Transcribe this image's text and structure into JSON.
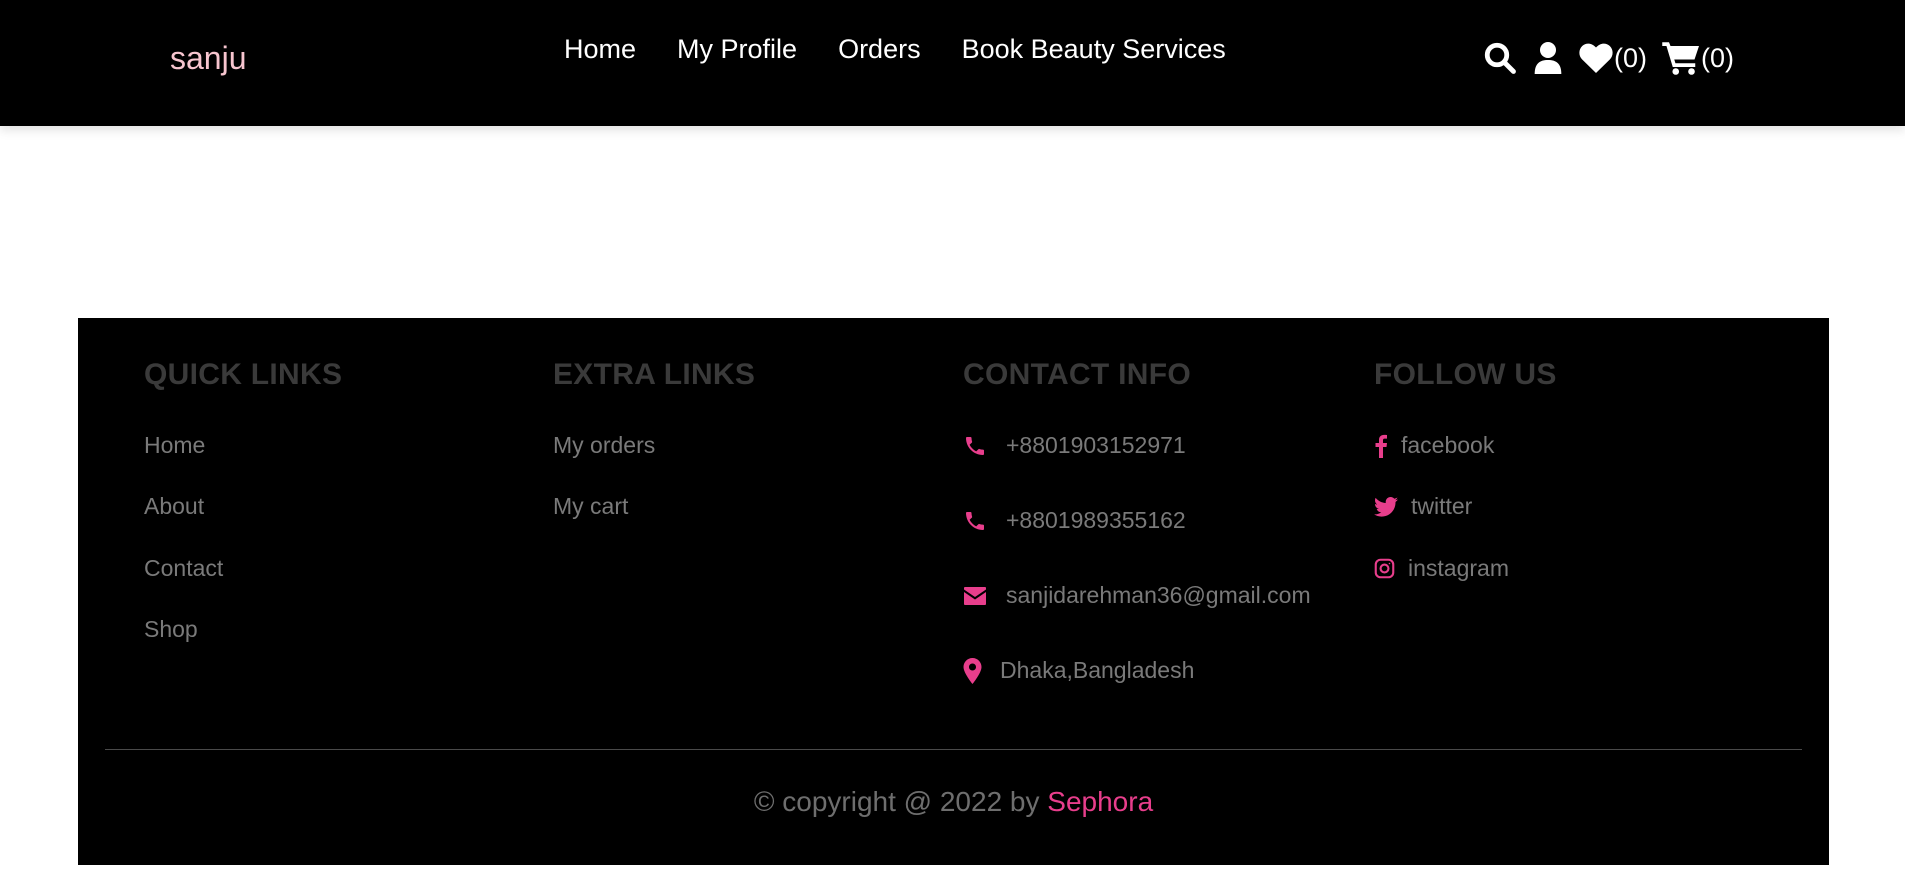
{
  "header": {
    "logo": "sanju",
    "nav": [
      "Home",
      "My Profile",
      "Orders",
      "Book Beauty Services"
    ],
    "icons": {
      "search": "search-icon",
      "user": "user-icon",
      "wishlist": "heart-icon",
      "wishlist_count": "(0)",
      "cart": "cart-icon",
      "cart_count": "(0)"
    }
  },
  "footer": {
    "quick_links": {
      "title": "quick links",
      "items": [
        "Home",
        "About",
        "Contact",
        "Shop"
      ]
    },
    "extra_links": {
      "title": "extra links",
      "items": [
        "My orders",
        "My cart"
      ]
    },
    "contact_info": {
      "title": "contact info",
      "phone1": "+8801903152971",
      "phone2": "+8801989355162",
      "email": "sanjidarehman36@gmail.com",
      "location": "Dhaka,Bangladesh"
    },
    "follow_us": {
      "title": "follow us",
      "facebook": "facebook",
      "twitter": "twitter",
      "instagram": "instagram"
    },
    "credit": {
      "prefix": "© copyright @ 2022 by ",
      "brand": "Sephora"
    }
  },
  "colors": {
    "accent": "#e83e8c",
    "logo": "#f7c5cf",
    "background": "#000000",
    "muted_text": "#7a7a7a",
    "footer_title": "#3a3a3a"
  }
}
